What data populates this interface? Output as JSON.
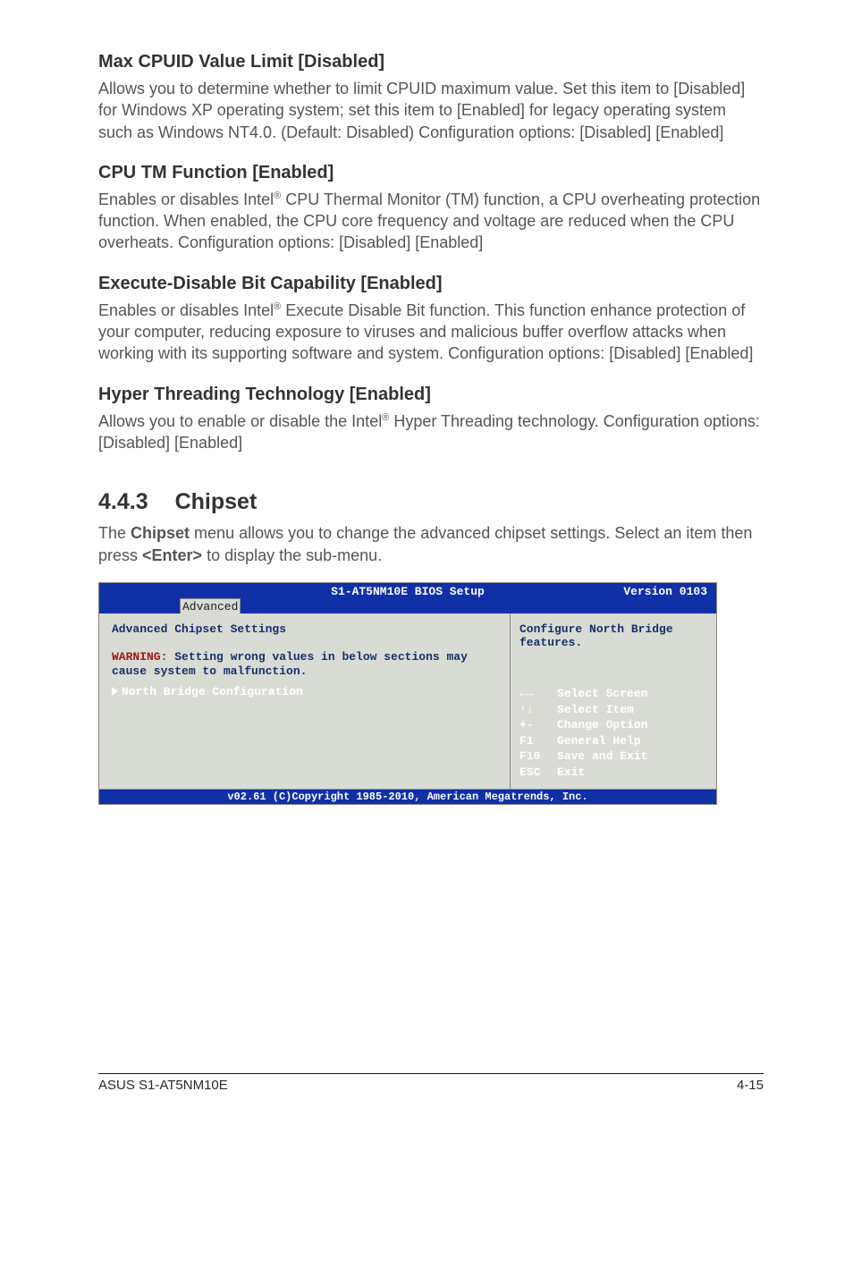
{
  "headings": {
    "h1": "Max CPUID Value Limit [Disabled]",
    "h2": "CPU TM Function [Enabled]",
    "h3": "Execute-Disable Bit Capability [Enabled]",
    "h4": "Hyper Threading Technology [Enabled]",
    "section_num": "4.4.3",
    "section_title": "Chipset"
  },
  "para": {
    "p1": "Allows you to determine whether to limit CPUID maximum value. Set this item to [Disabled] for Windows XP operating system; set this item to [Enabled] for legacy operating system such as Windows NT4.0. (Default: Disabled) Configuration options: [Disabled] [Enabled]",
    "p2a": "Enables or disables Intel",
    "p2b": " CPU Thermal Monitor (TM) function, a CPU overheating protection function. When enabled, the CPU core frequency and voltage are reduced when the CPU overheats. Configuration options: [Disabled] [Enabled]",
    "p3a": "Enables or disables Intel",
    "p3b": " Execute Disable Bit function. This function enhance protection of your computer, reducing exposure to viruses and malicious buffer overflow attacks when working with its supporting software and system. Configuration options: [Disabled] [Enabled]",
    "p4a": "Allows you to enable or disable the Intel",
    "p4b": " Hyper Threading technology. Configuration options: [Disabled] [Enabled]",
    "intro_a": "The ",
    "intro_b": "Chipset",
    "intro_c": " menu allows you to change the advanced chipset settings. Select an item then press ",
    "intro_d": "<Enter>",
    "intro_e": " to display the sub-menu.",
    "reg": "®"
  },
  "bios": {
    "title": "S1-AT5NM10E BIOS Setup",
    "version": "Version 0103",
    "tab": "Advanced",
    "left_title": "Advanced Chipset Settings",
    "warn_prefix": "WARNING:",
    "warn_rest": " Setting wrong values in below sections may cause system to malfunction.",
    "selected": "North Bridge Configuration",
    "help": "Configure North Bridge features.",
    "legend": {
      "l1": "Select Screen",
      "l2": "Select Item",
      "k3": "+-",
      "l3": "Change Option",
      "k4": "F1",
      "l4": "General Help",
      "k5": "F10",
      "l5": "Save and Exit",
      "k6": "ESC",
      "l6": "Exit"
    },
    "footer": "v02.61 (C)Copyright 1985-2010, American Megatrends, Inc."
  },
  "pagefoot": {
    "left": "ASUS S1-AT5NM10E",
    "right": "4-15"
  }
}
